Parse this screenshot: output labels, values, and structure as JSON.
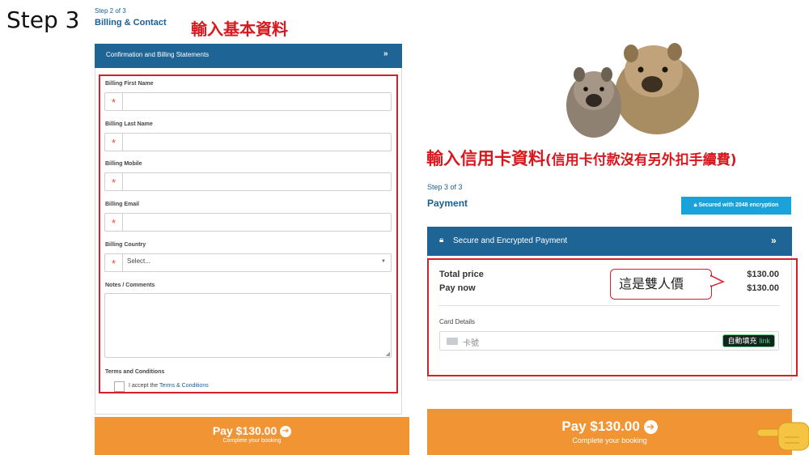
{
  "step_label": "Step 3",
  "left": {
    "step_small": "Step 2 of 3",
    "section_title": "Billing & Contact",
    "note": "輸入基本資料",
    "bar_label": "Confirmation and Billing Statements",
    "fields": {
      "first_name": "Billing First Name",
      "last_name": "Billing Last Name",
      "mobile": "Billing Mobile",
      "email": "Billing Email",
      "country": "Billing Country",
      "country_value": "Select...",
      "notes": "Notes / Comments"
    },
    "required_mark": "*",
    "terms_heading": "Terms and Conditions",
    "terms_prefix": "I accept the",
    "terms_link": "Terms & Conditions",
    "pay_amount": "Pay $130.00",
    "pay_sub": "Complete your booking"
  },
  "right": {
    "note": "輸入信用卡資料",
    "note_paren": "(信用卡付款沒有另外扣手續費)",
    "step_small": "Step 3 of 3",
    "section_title": "Payment",
    "badge": "Secured with 2048 encryption",
    "bar_label": "Secure and Encrypted Payment",
    "total_label": "Total price",
    "total_value": "$130.00",
    "paynow_label": "Pay now",
    "paynow_value": "$130.00",
    "callout": "這是雙人價",
    "card_label": "Card Details",
    "card_placeholder": "卡號",
    "autofill": "自動填充",
    "autofill_link": "link",
    "pay_amount": "Pay $130.00",
    "pay_sub": "Complete your booking"
  },
  "icons": {
    "chevron": "double-chevron-down-icon",
    "lock": "lock-icon",
    "arrow": "arrow-right-circle-icon",
    "card": "credit-card-icon",
    "hand": "pointing-hand-icon",
    "photo": "wombat-photo"
  },
  "colors": {
    "bar_blue": "#1e6495",
    "pay_orange": "#f19434",
    "annotation_red": "#d8181e",
    "badge_blue": "#1aa3db"
  }
}
